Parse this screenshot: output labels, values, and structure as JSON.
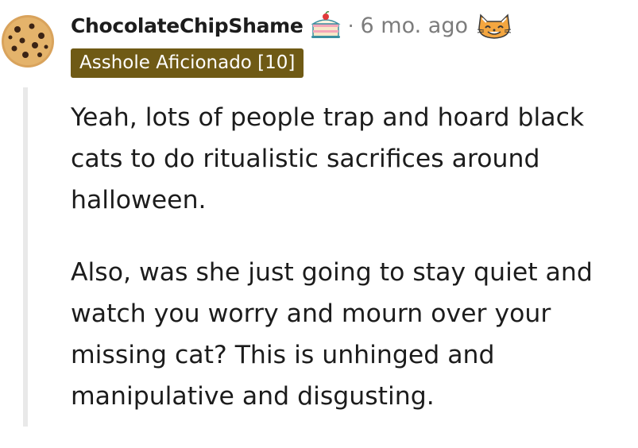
{
  "comment": {
    "username": "ChocolateChipShame",
    "award_icon": "cake-icon",
    "separator": "·",
    "timestamp": "6 mo. ago",
    "reaction_icon": "cat-face-icon",
    "flair": "Asshole Aficionado [10]",
    "avatar_icon": "cookie-avatar-icon",
    "paragraphs": [
      "Yeah, lots of people trap and hoard black cats to do ritualistic sacrifices around halloween.",
      "Also, was she just going to stay quiet and watch you worry and mourn over your missing cat? This is unhinged and manipulative and disgusting."
    ]
  },
  "colors": {
    "flair_bg": "#6f5a15",
    "meta_text": "#7c7c7c",
    "thread_line": "#e9e9e9"
  }
}
